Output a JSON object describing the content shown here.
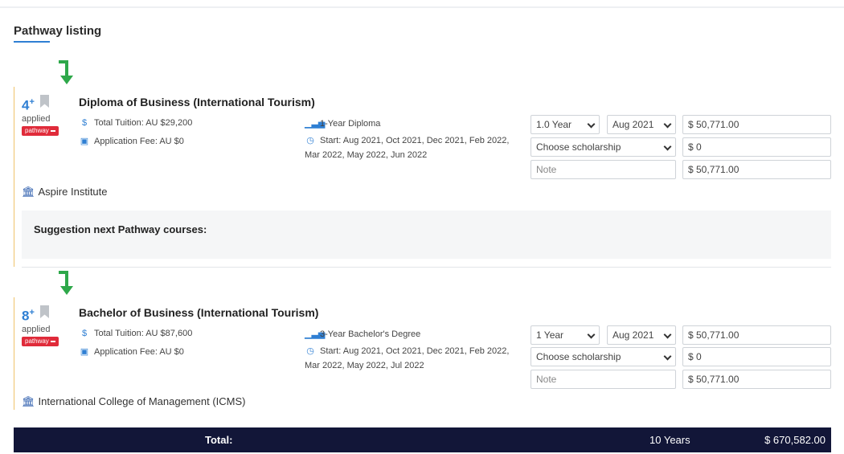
{
  "section": {
    "title": "Pathway listing"
  },
  "courses": [
    {
      "applied_count": "4",
      "applied_plus": "+",
      "applied_label": "applied",
      "badge": "pathway",
      "name": "Diploma of Business (International Tourism)",
      "total_tuition": "Total Tuition: AU $29,200",
      "application_fee": "Application Fee: AU $0",
      "course_type": "1-Year Diploma",
      "start": "Start: Aug 2021, Oct 2021, Dec 2021, Feb 2022, Mar 2022, May 2022, Jun 2022",
      "duration_select": "1.0 Year",
      "intake_select": "Aug 2021",
      "fee_value": "$ 50,771.00",
      "scholarship_select": "Choose scholarship",
      "scholarship_value": "$ 0",
      "note_placeholder": "Note",
      "net_value": "$ 50,771.00",
      "institute": "Aspire Institute",
      "suggestion_label": "Suggestion next Pathway courses:"
    },
    {
      "applied_count": "8",
      "applied_plus": "+",
      "applied_label": "applied",
      "badge": "pathway",
      "name": "Bachelor of Business (International Tourism)",
      "total_tuition": "Total Tuition: AU $87,600",
      "application_fee": "Application Fee: AU $0",
      "course_type": "3-Year Bachelor's Degree",
      "start": "Start: Aug 2021, Oct 2021, Dec 2021, Feb 2022, Mar 2022, May 2022, Jul 2022",
      "duration_select": "1 Year",
      "intake_select": "Aug 2021",
      "fee_value": "$ 50,771.00",
      "scholarship_select": "Choose scholarship",
      "scholarship_value": "$ 0",
      "note_placeholder": "Note",
      "net_value": "$ 50,771.00",
      "institute": "International College of Management (ICMS)"
    }
  ],
  "total": {
    "label": "Total:",
    "duration": "10 Years",
    "amount": "$ 670,582.00"
  },
  "colors": {
    "accent": "#2f7fd3",
    "arrow": "#2ea84a",
    "badge": "#e02b3a",
    "total_bar": "#121638"
  },
  "icons": [
    "arrow-down-right-icon",
    "bookmark-icon",
    "dollar-icon",
    "money-icon",
    "signal-bars-icon",
    "clock-icon",
    "institution-icon",
    "chevron-down-icon"
  ]
}
